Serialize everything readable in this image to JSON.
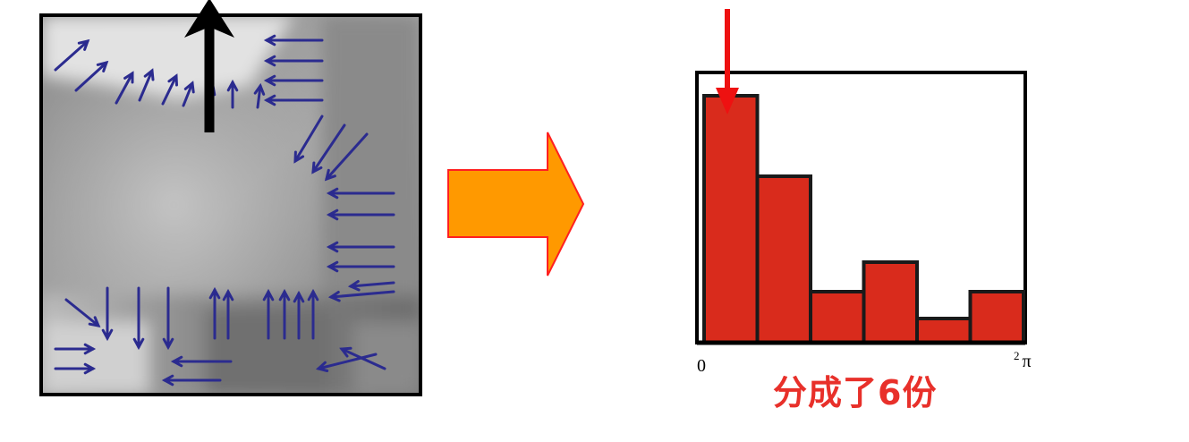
{
  "colors": {
    "gradient_arrow": "#2b2b8f",
    "dominant_arrow": "#000000",
    "big_arrow_fill": "#ff9900",
    "big_arrow_stroke": "#ff2020",
    "bar_fill": "#d92b1c",
    "peak_marker": "#ee1111",
    "caption": "#e8302a"
  },
  "chart_data": {
    "type": "bar",
    "bins": 6,
    "values": [
      0.92,
      0.62,
      0.19,
      0.3,
      0.09,
      0.19
    ],
    "ylim": [
      0,
      1
    ],
    "xlim_labels": [
      "0",
      "2",
      "π"
    ],
    "caption": "分成了6份"
  },
  "labels": {
    "x_min": "0",
    "x_max_sup": "2",
    "x_max_pi": "π",
    "caption": "分成了6份"
  }
}
